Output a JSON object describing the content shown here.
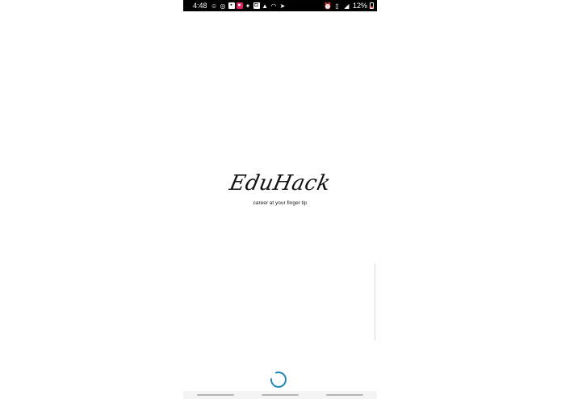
{
  "status_bar": {
    "time": "4:48",
    "battery_percent": "12%",
    "left_icons": [
      "emoji-icon",
      "record-icon",
      "game-icon",
      "red-app-icon",
      "twitter-icon",
      "instagram-icon",
      "alert-icon",
      "wifi-icon",
      "telegram-icon"
    ],
    "right_icons": [
      "alarm-icon",
      "vibrate-icon",
      "signal-icon",
      "battery-icon"
    ]
  },
  "splash": {
    "logo_text": "EduHack",
    "tagline": "career at your finger tip"
  },
  "colors": {
    "status_bar_bg": "#000000",
    "background": "#ffffff",
    "spinner": "#1e88b8",
    "nav_bar_bg": "#f4f4f4"
  }
}
